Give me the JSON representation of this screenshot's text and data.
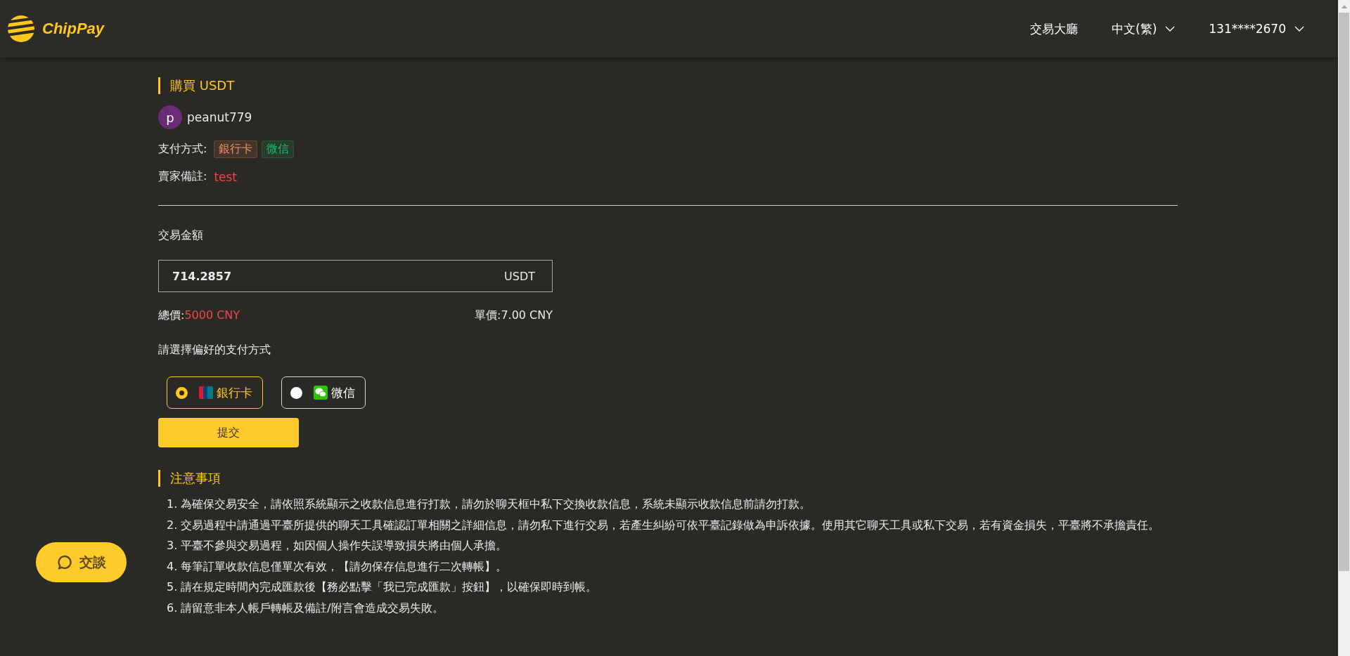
{
  "header": {
    "logo": "ChipPay",
    "nav": [
      {
        "label": "交易大廳"
      }
    ],
    "language": "中文(繁)",
    "user": "131****2670"
  },
  "order": {
    "title": "購買 USDT",
    "seller": {
      "avatar_letter": "p",
      "name": "peanut779"
    },
    "payment_label": "支付方式:",
    "payment_tags": [
      {
        "label": "銀行卡",
        "color": "#f0905a"
      },
      {
        "label": "微信",
        "color": "#19be6b"
      }
    ],
    "remark_label": "賣家備註:",
    "remark": "test"
  },
  "trade": {
    "amount_label": "交易金額",
    "amount": "714.2857",
    "unit": "USDT",
    "total_label": "總價:",
    "total": "5000 CNY",
    "price_label": "單價:",
    "price": "7.00 CNY",
    "method_prompt": "請選擇偏好的支付方式",
    "methods": [
      {
        "kind": "bank",
        "label": "銀行卡",
        "selected": true
      },
      {
        "kind": "wechat",
        "label": "微信",
        "selected": false
      }
    ],
    "submit": "提交"
  },
  "notes": {
    "title": "注意事項",
    "items": [
      "1. 為確保交易安全，請依照系統顯示之收款信息進行打款，請勿於聊天框中私下交換收款信息，系統未顯示收款信息前請勿打款。",
      "2. 交易過程中請通過平臺所提供的聊天工具確認訂單相關之詳細信息，請勿私下進行交易，若產生糾紛可依平臺記錄做為申訴依據。使用其它聊天工具或私下交易，若有資金損失，平臺將不承擔責任。",
      "3. 平臺不參與交易過程，如因個人操作失誤導致損失將由個人承擔。",
      "4. 每筆訂單收款信息僅單次有效，【請勿保存信息進行二次轉帳】。",
      "5. 請在規定時間內完成匯款後【務必點擊「我已完成匯款」按鈕】，以確保即時到帳。",
      "6. 請留意非本人帳戶轉帳及備註/附言會造成交易失敗。"
    ]
  },
  "chat": {
    "label": "交談"
  }
}
